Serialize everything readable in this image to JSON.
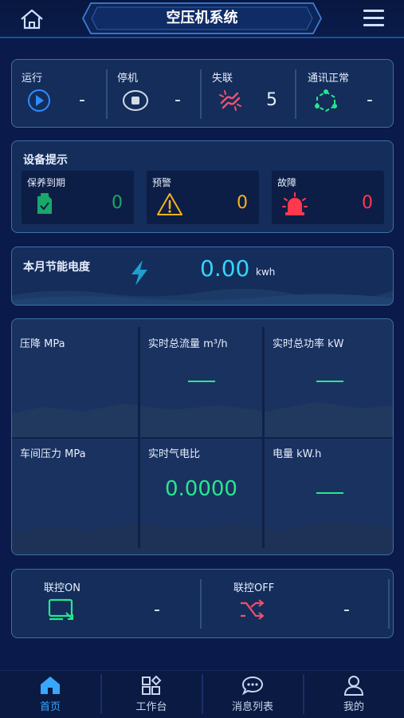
{
  "header": {
    "title": "空压机系统",
    "home_icon": "home-icon",
    "menu_icon": "hamburger-menu-icon"
  },
  "status": [
    {
      "label": "运行",
      "value": "-",
      "icon": "play-icon",
      "color": "#2e8cff"
    },
    {
      "label": "停机",
      "value": "-",
      "icon": "stop-icon",
      "color": "#d5dbe7"
    },
    {
      "label": "失联",
      "value": "5",
      "icon": "broken-link-icon",
      "color": "#f0506e"
    },
    {
      "label": "通讯正常",
      "value": "-",
      "icon": "network-icon",
      "color": "#27e78e"
    }
  ],
  "hints": {
    "title": "设备提示",
    "items": [
      {
        "label": "保养到期",
        "value": "0",
        "icon": "maintenance-icon",
        "color": "#18a86a"
      },
      {
        "label": "预警",
        "value": "0",
        "icon": "warning-icon",
        "color": "#f6b21c"
      },
      {
        "label": "故障",
        "value": "0",
        "icon": "alarm-siren-icon",
        "color": "#ff3850"
      }
    ]
  },
  "energy": {
    "label": "本月节能电度",
    "value": "0.00",
    "unit": "kwh",
    "icon": "lightning-icon",
    "color": "#35d3ff"
  },
  "metrics": [
    {
      "label": "压降 MPa",
      "value": ""
    },
    {
      "label": "实时总流量 m³/h",
      "value": "—"
    },
    {
      "label": "实时总功率 kW",
      "value": "—"
    },
    {
      "label": "车间压力 MPa",
      "value": ""
    },
    {
      "label": "实时气电比",
      "value": "0.0000"
    },
    {
      "label": "电量 kW.h",
      "value": "—"
    }
  ],
  "linkage": [
    {
      "label": "联控ON",
      "value": "-",
      "icon": "monitor-icon",
      "color": "#27e78e"
    },
    {
      "label": "联控OFF",
      "value": "-",
      "icon": "shuffle-icon",
      "color": "#f0506e"
    }
  ],
  "nav": [
    {
      "label": "首页",
      "icon": "home-icon",
      "active": true
    },
    {
      "label": "工作台",
      "icon": "grid-icon",
      "active": false
    },
    {
      "label": "消息列表",
      "icon": "chat-icon",
      "active": false
    },
    {
      "label": "我的",
      "icon": "user-icon",
      "active": false
    }
  ]
}
